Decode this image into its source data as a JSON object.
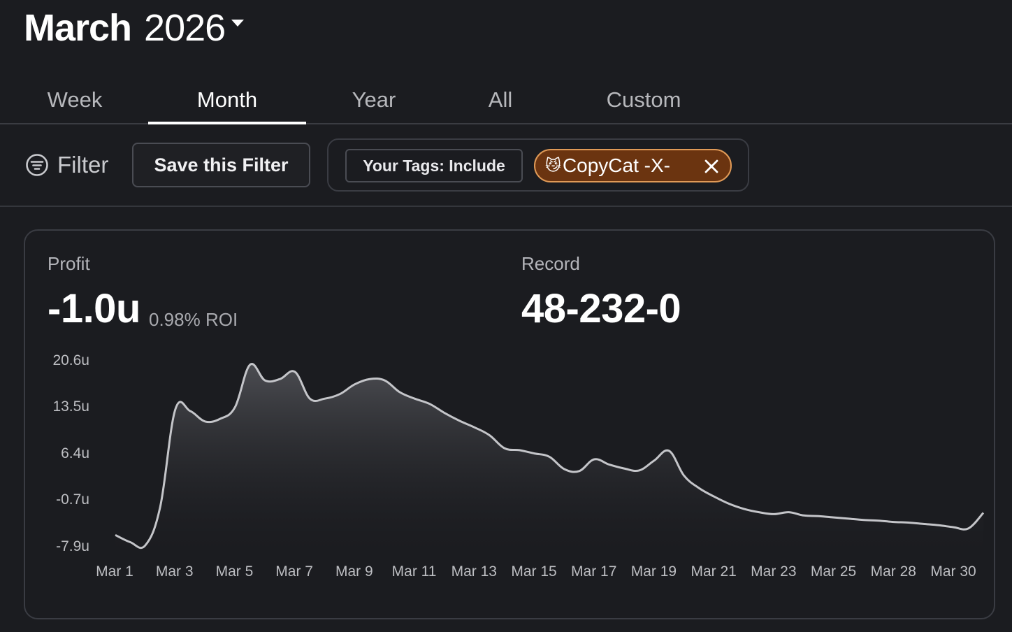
{
  "header": {
    "month": "March",
    "year": "2026"
  },
  "tabs": [
    {
      "label": "Week"
    },
    {
      "label": "Month"
    },
    {
      "label": "Year"
    },
    {
      "label": "All"
    },
    {
      "label": "Custom"
    }
  ],
  "active_tab": "Month",
  "filter": {
    "label": "Filter",
    "save_label": "Save this Filter",
    "include_label": "Your Tags: Include",
    "tag_emoji": "😼",
    "tag_label": "CopyCat -X-"
  },
  "stats": {
    "profit_label": "Profit",
    "profit_value": "-1.0u",
    "roi": "0.98% ROI",
    "record_label": "Record",
    "record_value": "48-232-0"
  },
  "chart_data": {
    "type": "area",
    "y_ticks": [
      "20.6u",
      "13.5u",
      "6.4u",
      "-0.7u",
      "-7.9u"
    ],
    "ylim": [
      -7.9,
      20.6
    ],
    "x_ticks": [
      "Mar 1",
      "Mar 3",
      "Mar 5",
      "Mar 7",
      "Mar 9",
      "Mar 11",
      "Mar 13",
      "Mar 15",
      "Mar 17",
      "Mar 19",
      "Mar 21",
      "Mar 23",
      "Mar 25",
      "Mar 28",
      "Mar 30"
    ],
    "x": [
      0,
      0.5,
      1,
      1.5,
      2,
      2.5,
      3,
      3.5,
      4,
      4.5,
      5,
      5.5,
      6,
      6.5,
      7,
      7.5,
      8,
      8.5,
      9,
      9.5,
      10,
      10.5,
      11,
      11.5,
      12,
      12.5,
      13,
      13.5,
      14,
      14.5,
      15,
      15.5,
      16,
      16.5,
      17,
      17.5,
      18,
      18.5,
      19,
      19.5,
      20,
      20.5,
      21,
      21.5,
      22,
      22.5,
      23,
      23.5,
      24,
      24.5,
      25,
      25.5,
      26,
      26.5,
      27,
      27.5,
      28,
      28.5,
      29
    ],
    "y": [
      -6.0,
      -7.1,
      -7.6,
      -1.7,
      13.2,
      13.0,
      11.4,
      11.8,
      13.6,
      20.1,
      17.7,
      17.9,
      19.0,
      14.9,
      14.9,
      15.6,
      17.1,
      17.9,
      17.7,
      15.9,
      14.9,
      14.1,
      12.7,
      11.5,
      10.5,
      9.3,
      7.3,
      7.0,
      6.5,
      6.0,
      4.1,
      3.8,
      5.6,
      4.8,
      4.2,
      3.9,
      5.4,
      6.9,
      3.1,
      1.2,
      -0.1,
      -1.2,
      -2.0,
      -2.5,
      -2.8,
      -2.5,
      -3.0,
      -3.1,
      -3.3,
      -3.5,
      -3.7,
      -3.8,
      -4.0,
      -4.1,
      -4.3,
      -4.5,
      -4.8,
      -5.0,
      -2.6
    ],
    "grid": false,
    "legend": "none"
  }
}
